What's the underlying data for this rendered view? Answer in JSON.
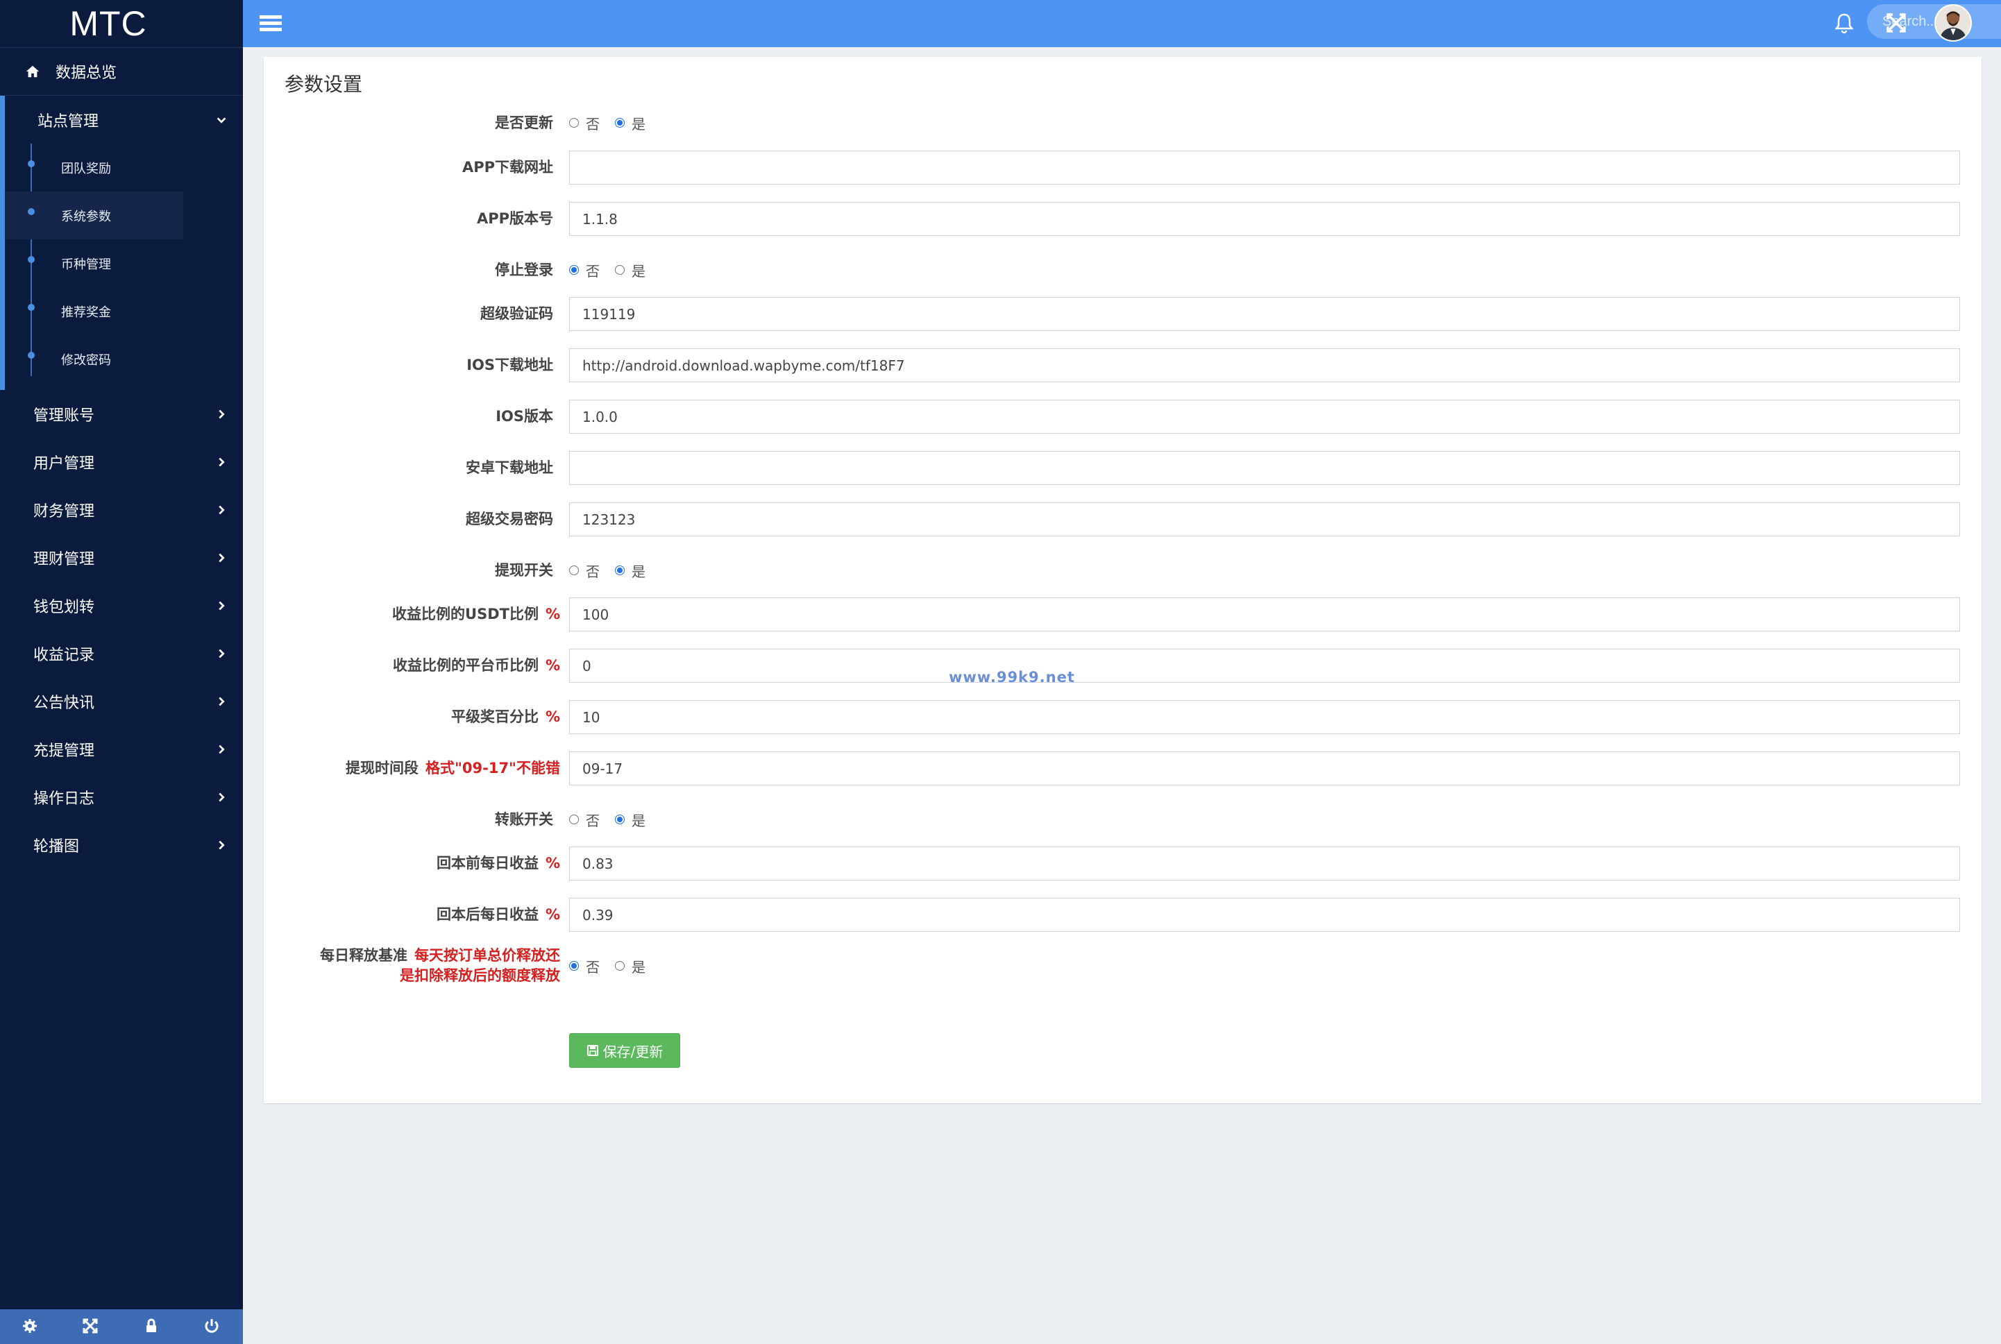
{
  "brand": "MTC",
  "sidebar": {
    "top_item": {
      "label": "数据总览",
      "icon": "home-icon"
    },
    "open_group": {
      "label": "站点管理",
      "items": [
        {
          "label": "团队奖励"
        },
        {
          "label": "系统参数",
          "active": true
        },
        {
          "label": "币种管理"
        },
        {
          "label": "推荐奖金"
        },
        {
          "label": "修改密码"
        }
      ]
    },
    "groups": [
      {
        "label": "管理账号"
      },
      {
        "label": "用户管理"
      },
      {
        "label": "财务管理"
      },
      {
        "label": "理财管理"
      },
      {
        "label": "钱包划转"
      },
      {
        "label": "收益记录"
      },
      {
        "label": "公告快讯"
      },
      {
        "label": "充提管理"
      },
      {
        "label": "操作日志"
      },
      {
        "label": "轮播图"
      }
    ],
    "footer_icons": [
      "gear-icon",
      "expand-icon",
      "lock-icon",
      "power-icon"
    ]
  },
  "topbar": {
    "search_placeholder": "Search...",
    "icons": [
      "bell-icon",
      "fullscreen-icon",
      "avatar"
    ]
  },
  "panel": {
    "title": "参数设置",
    "fields": [
      {
        "label": "是否更新",
        "type": "radio",
        "options": [
          "否",
          "是"
        ],
        "selected": "是"
      },
      {
        "label": "APP下载网址",
        "type": "text",
        "value": ""
      },
      {
        "label": "APP版本号",
        "type": "text",
        "value": "1.1.8"
      },
      {
        "label": "停止登录",
        "type": "radio",
        "options": [
          "否",
          "是"
        ],
        "selected": "否"
      },
      {
        "label": "超级验证码",
        "type": "text",
        "value": "119119"
      },
      {
        "label": "IOS下载地址",
        "type": "text",
        "value": "http://android.download.wapbyme.com/tf18F7"
      },
      {
        "label": "IOS版本",
        "type": "text",
        "value": "1.0.0"
      },
      {
        "label": "安卓下载地址",
        "type": "text",
        "value": ""
      },
      {
        "label": "超级交易密码",
        "type": "text",
        "value": "123123"
      },
      {
        "label": "提现开关",
        "type": "radio",
        "options": [
          "否",
          "是"
        ],
        "selected": "是"
      },
      {
        "label": "收益比例的USDT比例",
        "suffix": "%",
        "type": "text",
        "value": "100"
      },
      {
        "label": "收益比例的平台币比例",
        "suffix": "%",
        "type": "text",
        "value": "0"
      },
      {
        "label": "平级奖百分比",
        "suffix": "%",
        "type": "text",
        "value": "10"
      },
      {
        "label": "提现时间段",
        "note": "格式\"09-17\"不能错",
        "type": "text",
        "value": "09-17"
      },
      {
        "label": "转账开关",
        "type": "radio",
        "options": [
          "否",
          "是"
        ],
        "selected": "是"
      },
      {
        "label": "回本前每日收益",
        "suffix": "%",
        "type": "text",
        "value": "0.83"
      },
      {
        "label": "回本后每日收益",
        "suffix": "%",
        "type": "text",
        "value": "0.39"
      },
      {
        "label": "每日释放基准",
        "note_lines": [
          "每天按订单总价释放还",
          "是扣除释放后的额度释放"
        ],
        "type": "radio",
        "options": [
          "否",
          "是"
        ],
        "selected": "否"
      }
    ],
    "save_label": "保存/更新",
    "watermark": "www.99k9.net"
  },
  "colors": {
    "sidebar_bg": "#0b1b3d",
    "topbar_bg": "#4d94f5",
    "accent": "#4a90e2",
    "save_button": "#5cb85c",
    "note_red": "#d42020"
  }
}
